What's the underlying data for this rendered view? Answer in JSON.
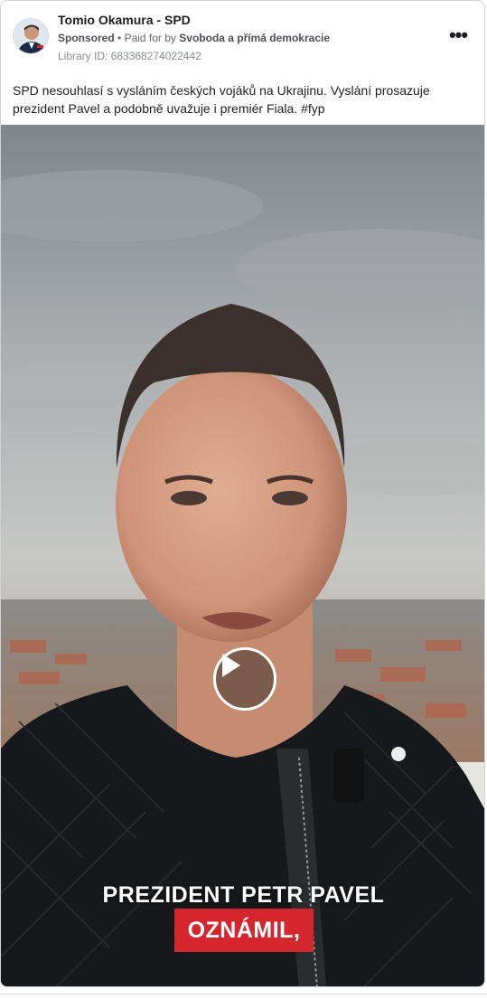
{
  "ad": {
    "page_name": "Tomio Okamura - SPD",
    "sponsored_label": "Sponsored",
    "separator": "•",
    "paid_for_prefix": "Paid for by",
    "payer": "Svoboda a přímá demokracie",
    "library_id": "Library ID: 683368274022442",
    "more_icon": "more-options-icon",
    "caption": "SPD nesouhlasí s vysláním českých vojáků na Ukrajinu. Vyslání prosazuje prezident Pavel a podobně uvažuje i premiér Fiala. #fyp"
  },
  "video": {
    "subtitle_line1": "PREZIDENT PETR PAVEL",
    "subtitle_line2": "OZNÁMIL,",
    "play_icon": "play-icon",
    "subtitle_highlight_color": "#d4262c"
  }
}
